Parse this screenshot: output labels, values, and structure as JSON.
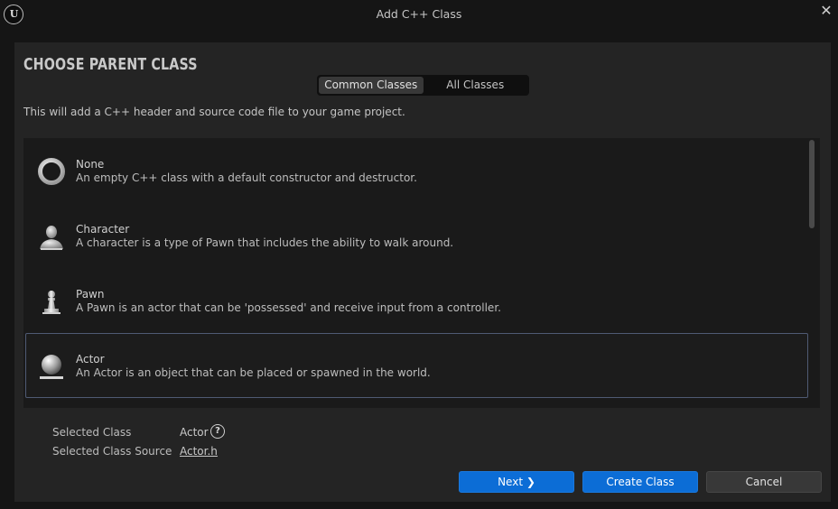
{
  "window": {
    "title": "Add C++ Class",
    "logo_text": "U",
    "close_glyph": "✕"
  },
  "panel": {
    "heading": "CHOOSE PARENT CLASS",
    "tabs": [
      {
        "label": "Common Classes",
        "active": true
      },
      {
        "label": "All Classes",
        "active": false
      }
    ],
    "description": "This will add a C++ header and source code file to your game project."
  },
  "classes": [
    {
      "name": "None",
      "description": "An empty C++ class with a default constructor and destructor.",
      "icon": "ring-icon",
      "selected": false
    },
    {
      "name": "Character",
      "description": "A character is a type of Pawn that includes the ability to walk around.",
      "icon": "character-icon",
      "selected": false
    },
    {
      "name": "Pawn",
      "description": "A Pawn is an actor that can be 'possessed' and receive input from a controller.",
      "icon": "pawn-icon",
      "selected": false
    },
    {
      "name": "Actor",
      "description": "An Actor is an object that can be placed or spawned in the world.",
      "icon": "actor-sphere-icon",
      "selected": true
    }
  ],
  "selection": {
    "class_label": "Selected Class",
    "class_value": "Actor",
    "source_label": "Selected Class Source",
    "source_value": "Actor.h",
    "help_glyph": "?"
  },
  "buttons": {
    "next": "Next ❯",
    "create": "Create Class",
    "cancel": "Cancel"
  },
  "colors": {
    "accent": "#0c6dd6",
    "selection_border": "#4f5a73",
    "panel_bg": "#242424"
  }
}
